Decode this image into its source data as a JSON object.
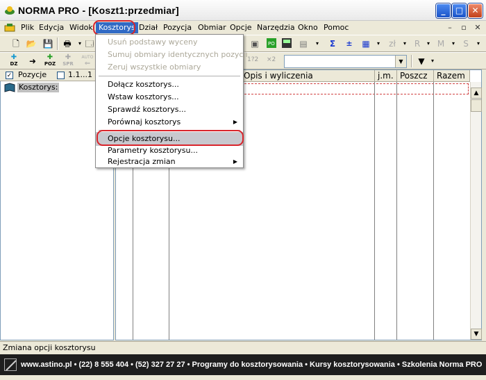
{
  "window": {
    "title": "NORMA PRO - [Koszt1:przedmiar]"
  },
  "menubar": {
    "items": [
      "Plik",
      "Edycja",
      "Widok",
      "Kosztorys",
      "Dział",
      "Pozycja",
      "Obmiar",
      "Opcje",
      "Narzędzia",
      "Okno",
      "Pomoc"
    ],
    "active": "Kosztorys"
  },
  "toolbar2": {
    "labels": [
      "DZ",
      "POZ",
      "SPR",
      "AUTO"
    ],
    "counter": "1?2",
    "counter2": "×2"
  },
  "left_panel": {
    "check_label": "Pozycje",
    "range_label": "1.1...1",
    "tree_root": "Kosztorys:"
  },
  "grid": {
    "columns": [
      "Opis i wyliczenia",
      "j.m.",
      "Poszcz",
      "Razem"
    ]
  },
  "dropdown": {
    "items": [
      {
        "label": "Usuń podstawy wyceny",
        "disabled": true
      },
      {
        "label": "Sumuj obmiary identycznych pozycji",
        "disabled": true
      },
      {
        "label": "Zeruj wszystkie obmiary",
        "disabled": true
      },
      {
        "label": "Dołącz kosztorys...",
        "disabled": false
      },
      {
        "label": "Wstaw kosztorys...",
        "disabled": false
      },
      {
        "label": "Sprawdź kosztorys...",
        "disabled": false
      },
      {
        "label": "Porównaj kosztorys",
        "disabled": false,
        "submenu": true
      },
      {
        "label": "Opcje kosztorysu...",
        "disabled": false,
        "highlighted": true
      },
      {
        "label": "Parametry kosztorysu...",
        "disabled": false
      },
      {
        "label": "Rejestracja zmian",
        "disabled": false,
        "submenu": true
      }
    ]
  },
  "status": {
    "text": "Zmiana opcji kosztorysu"
  },
  "footer": {
    "text": "www.astino.pl  •  (22) 8 555 404  •  (52) 327 27 27  •  Programy do kosztorysowania  •  Kursy kosztorysowania  •  Szkolenia Norma PRO"
  },
  "colors": {
    "highlight_ring": "#d9242b",
    "menu_hover": "#c8c8ce",
    "footer_bg": "#1e1e1e"
  }
}
